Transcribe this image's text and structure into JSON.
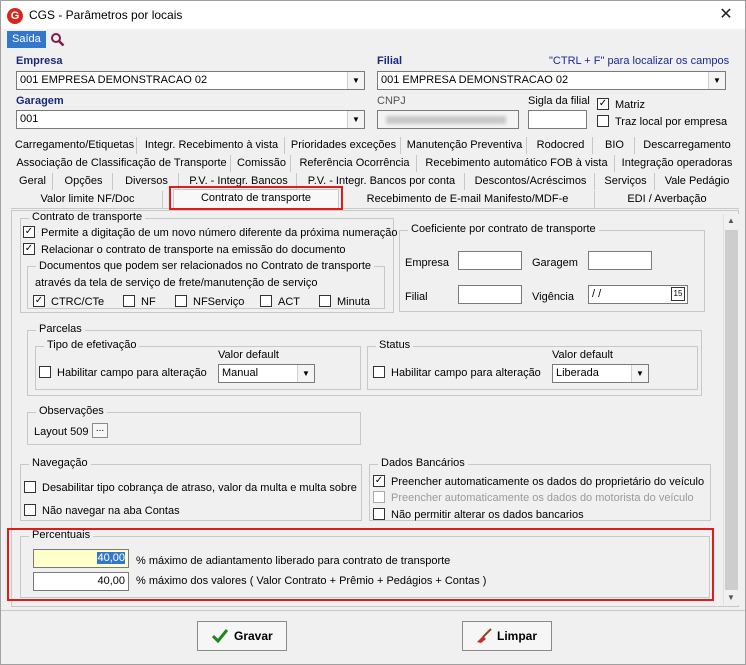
{
  "window": {
    "title": "CGS - Parâmetros por locais",
    "close_glyph": "✕",
    "logo_letter": "G"
  },
  "menu": {
    "saida": "Saída"
  },
  "header": {
    "empresa_label": "Empresa",
    "empresa_value": "001 EMPRESA DEMONSTRACAO 02",
    "filial_label": "Filial",
    "shortcut_hint": "\"CTRL + F\" para localizar os campos",
    "filial_value": "001 EMPRESA DEMONSTRACAO 02",
    "garagem_label": "Garagem",
    "garagem_value": "001",
    "cnpj_label": "CNPJ",
    "cnpj_value": "",
    "sigla_label": "Sigla da filial",
    "sigla_value": "",
    "matriz_label": "Matriz",
    "traz_local_label": "Traz local por empresa"
  },
  "tabs": {
    "row1": [
      "Carregamento/Etiquetas",
      "Integr. Recebimento à vista",
      "Prioridades exceções",
      "Manutenção Preventiva",
      "Rodocred",
      "BIO",
      "Descarregamento"
    ],
    "row2": [
      "Associação de Classificação de Transporte",
      "Comissão",
      "Referência Ocorrência",
      "Recebimento automático FOB à vista",
      "Integração operadoras"
    ],
    "row3": [
      "Geral",
      "Opções",
      "Diversos",
      "P.V. - Integr. Bancos",
      "P.V. - Integr. Bancos por conta",
      "Descontos/Acréscimos",
      "Serviços",
      "Vale Pedágio"
    ],
    "row4": [
      "Valor limite NF/Doc",
      "Contrato de transporte",
      "Recebimento de E-mail Manifesto/MDF-e",
      "EDI / Averbação"
    ]
  },
  "contrato": {
    "group_title": "Contrato de transporte",
    "permite_label": "Permite a digitação de um novo número diferente da próxima numeração",
    "relacionar_label": "Relacionar o contrato de transporte na emissão do documento",
    "docs_title": "Documentos que podem ser relacionados no Contrato de transporte",
    "docs_subtitle": "através da tela de serviço de frete/manutenção de serviço",
    "docs": [
      "CTRC/CTe",
      "NF",
      "NFServiço",
      "ACT",
      "Minuta"
    ]
  },
  "coef": {
    "title": "Coeficiente por contrato de transporte",
    "empresa_label": "Empresa",
    "garagem_label": "Garagem",
    "filial_label": "Filial",
    "vigencia_label": "Vigência",
    "vigencia_value": " /  /",
    "cal_label": "15"
  },
  "parcelas": {
    "title": "Parcelas",
    "tipo_title": "Tipo de efetivação",
    "habilitar1": "Habilitar campo para alteração",
    "valor_default1": "Valor default",
    "combo1": "Manual",
    "status_title": "Status",
    "habilitar2": "Habilitar campo para alteração",
    "valor_default2": "Valor default",
    "combo2": "Liberada"
  },
  "obs": {
    "title": "Observações",
    "layout": "Layout 509",
    "dots": "..."
  },
  "navegacao": {
    "title": "Navegação",
    "desabilitar": "Desabilitar tipo cobrança de atraso, valor da multa e multa sobre",
    "nao_navegar": "Não navegar na aba Contas"
  },
  "bancarios": {
    "title": "Dados Bancários",
    "item1": "Preencher automaticamente os dados do proprietário do veículo",
    "item2": "Preencher automaticamente os dados do motorista do veículo",
    "item3": "Não permitir alterar os dados bancarios"
  },
  "percentuais": {
    "title": "Percentuais",
    "value1": "40,00",
    "desc1": "% máximo de adiantamento liberado para contrato de transporte",
    "value2": "40,00",
    "desc2": "% máximo dos valores ( Valor Contrato + Prêmio + Pedágios + Contas )"
  },
  "buttons": {
    "gravar": "Gravar",
    "limpar": "Limpar"
  }
}
